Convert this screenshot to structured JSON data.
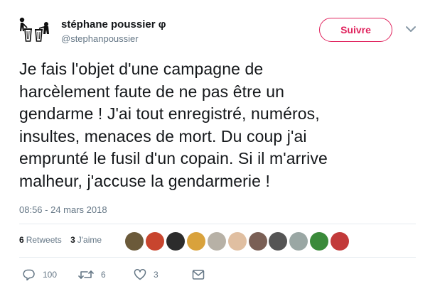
{
  "author": {
    "name": "stéphane poussier φ",
    "handle": "@stephanpoussier",
    "avatar_icon": "trash-people-icon"
  },
  "follow_button": {
    "label": "Suivre"
  },
  "menu": {
    "icon": "chevron-down-icon"
  },
  "tweet": {
    "lines": [
      "Je fais l'objet d'une campagne de",
      "harcèlement faute de ne pas être un",
      "gendarme ! J'ai tout enregistré, numéros,",
      "insultes, menaces de mort. Du coup j'ai",
      "emprunté le fusil d'un copain. Si il m'arrive",
      "malheur, j'accuse la gendarmerie !"
    ],
    "timestamp": "08:56 - 24 mars 2018"
  },
  "stats": {
    "retweets_count": "6",
    "retweets_label": "Retweets",
    "likes_count": "3",
    "likes_label": "J'aime"
  },
  "likers": [
    {
      "name": "liker-avatar-1",
      "color": "#6b5a3a"
    },
    {
      "name": "liker-avatar-2",
      "color": "#c8452e"
    },
    {
      "name": "liker-avatar-3",
      "color": "#2c2c2c"
    },
    {
      "name": "liker-avatar-4",
      "color": "#d9a23c"
    },
    {
      "name": "liker-avatar-5",
      "color": "#b7b1a6"
    },
    {
      "name": "liker-avatar-6",
      "color": "#e0bfa1"
    },
    {
      "name": "liker-avatar-7",
      "color": "#7a5f55"
    },
    {
      "name": "liker-avatar-8",
      "color": "#555555"
    },
    {
      "name": "liker-avatar-9",
      "color": "#9aa7a4"
    },
    {
      "name": "liker-avatar-10",
      "color": "#3a8a3a"
    },
    {
      "name": "liker-avatar-11",
      "color": "#c23a3a"
    }
  ],
  "actions": {
    "reply_count": "100",
    "retweet_count": "6",
    "like_count": "3"
  },
  "colors": {
    "accent": "#e0245e",
    "secondary_text": "#657786",
    "primary_text": "#14171a",
    "divider": "#e6ecf0"
  }
}
